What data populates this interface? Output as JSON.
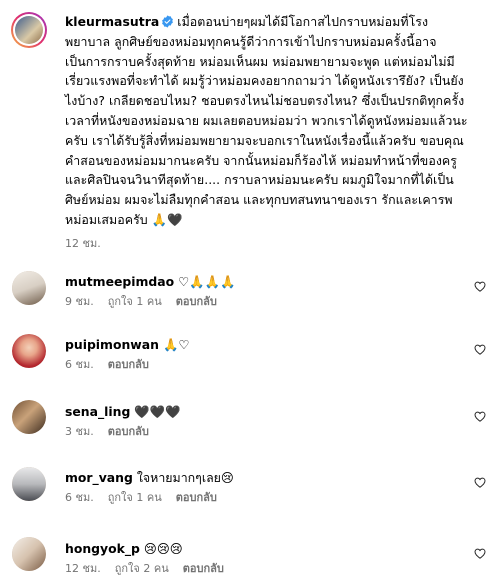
{
  "post": {
    "username": "kleurmasutra",
    "caption": "เมื่อตอนบ่ายๆผมได้มีโอกาสไปกราบหม่อมที่โรงพยาบาล ลูกศิษย์ของหม่อมทุกคนรู้ดีว่าการเข้าไปกราบหม่อมครั้งนี้อาจเป็นการกราบครั้งสุดท้าย หม่อมเห็นผม หม่อมพยายามจะพูด แต่หม่อมไม่มีเรี่ยวแรงพอที่จะทำได้ ผมรู้ว่าหม่อมคงอยากถามว่า ได้ดูหนังเรารึยัง? เป็นยังไงบ้าง? เกลียดชอบไหม? ชอบตรงไหนไม่ชอบตรงไหน? ซึ่งเป็นปรกติทุกครั้งเวลาที่หนังของหม่อมฉาย ผมเลยตอบหม่อมว่า พวกเราได้ดูหนังหม่อมแล้วนะครับ เราได้รับรู้สิ่งที่หม่อมพยายามจะบอกเราในหนังเรื่องนี้แล้วครับ ขอบคุณคำสอนของหม่อมมากนะครับ จากนั้นหม่อมก็ร้องไห้ หม่อมทำหน้าที่ของครูและศิลปินจนวินาทีสุดท้าย.... กราบลาหม่อมนะครับ ผมภูมิใจมากที่ได้เป็นศิษย์หม่อม ผมจะไม่ลืมทุกคำสอน และทุกบทสนทนาของเรา รักและเคารพหม่อมเสมอครับ 🙏🖤",
    "time": "12 ชม."
  },
  "comments": [
    {
      "username": "mutmeepimdao",
      "text": "♡🙏🙏🙏",
      "time": "9 ชม.",
      "likes": "ถูกใจ 1 คน",
      "reply": "ตอบกลับ"
    },
    {
      "username": "puipimonwan",
      "text": "🙏♡",
      "time": "6 ชม.",
      "likes": "",
      "reply": "ตอบกลับ"
    },
    {
      "username": "sena_ling",
      "text": "🖤🖤🖤",
      "time": "3 ชม.",
      "likes": "",
      "reply": "ตอบกลับ"
    },
    {
      "username": "mor_vang",
      "text": "ใจหายมากๆเลย😢",
      "time": "6 ชม.",
      "likes": "ถูกใจ 1 คน",
      "reply": "ตอบกลับ"
    },
    {
      "username": "hongyok_p",
      "text": "😢😢😢",
      "time": "12 ชม.",
      "likes": "ถูกใจ 2 คน",
      "reply": "ตอบกลับ"
    }
  ],
  "colors": {
    "verified": "#3897f0",
    "muted": "#737373"
  }
}
